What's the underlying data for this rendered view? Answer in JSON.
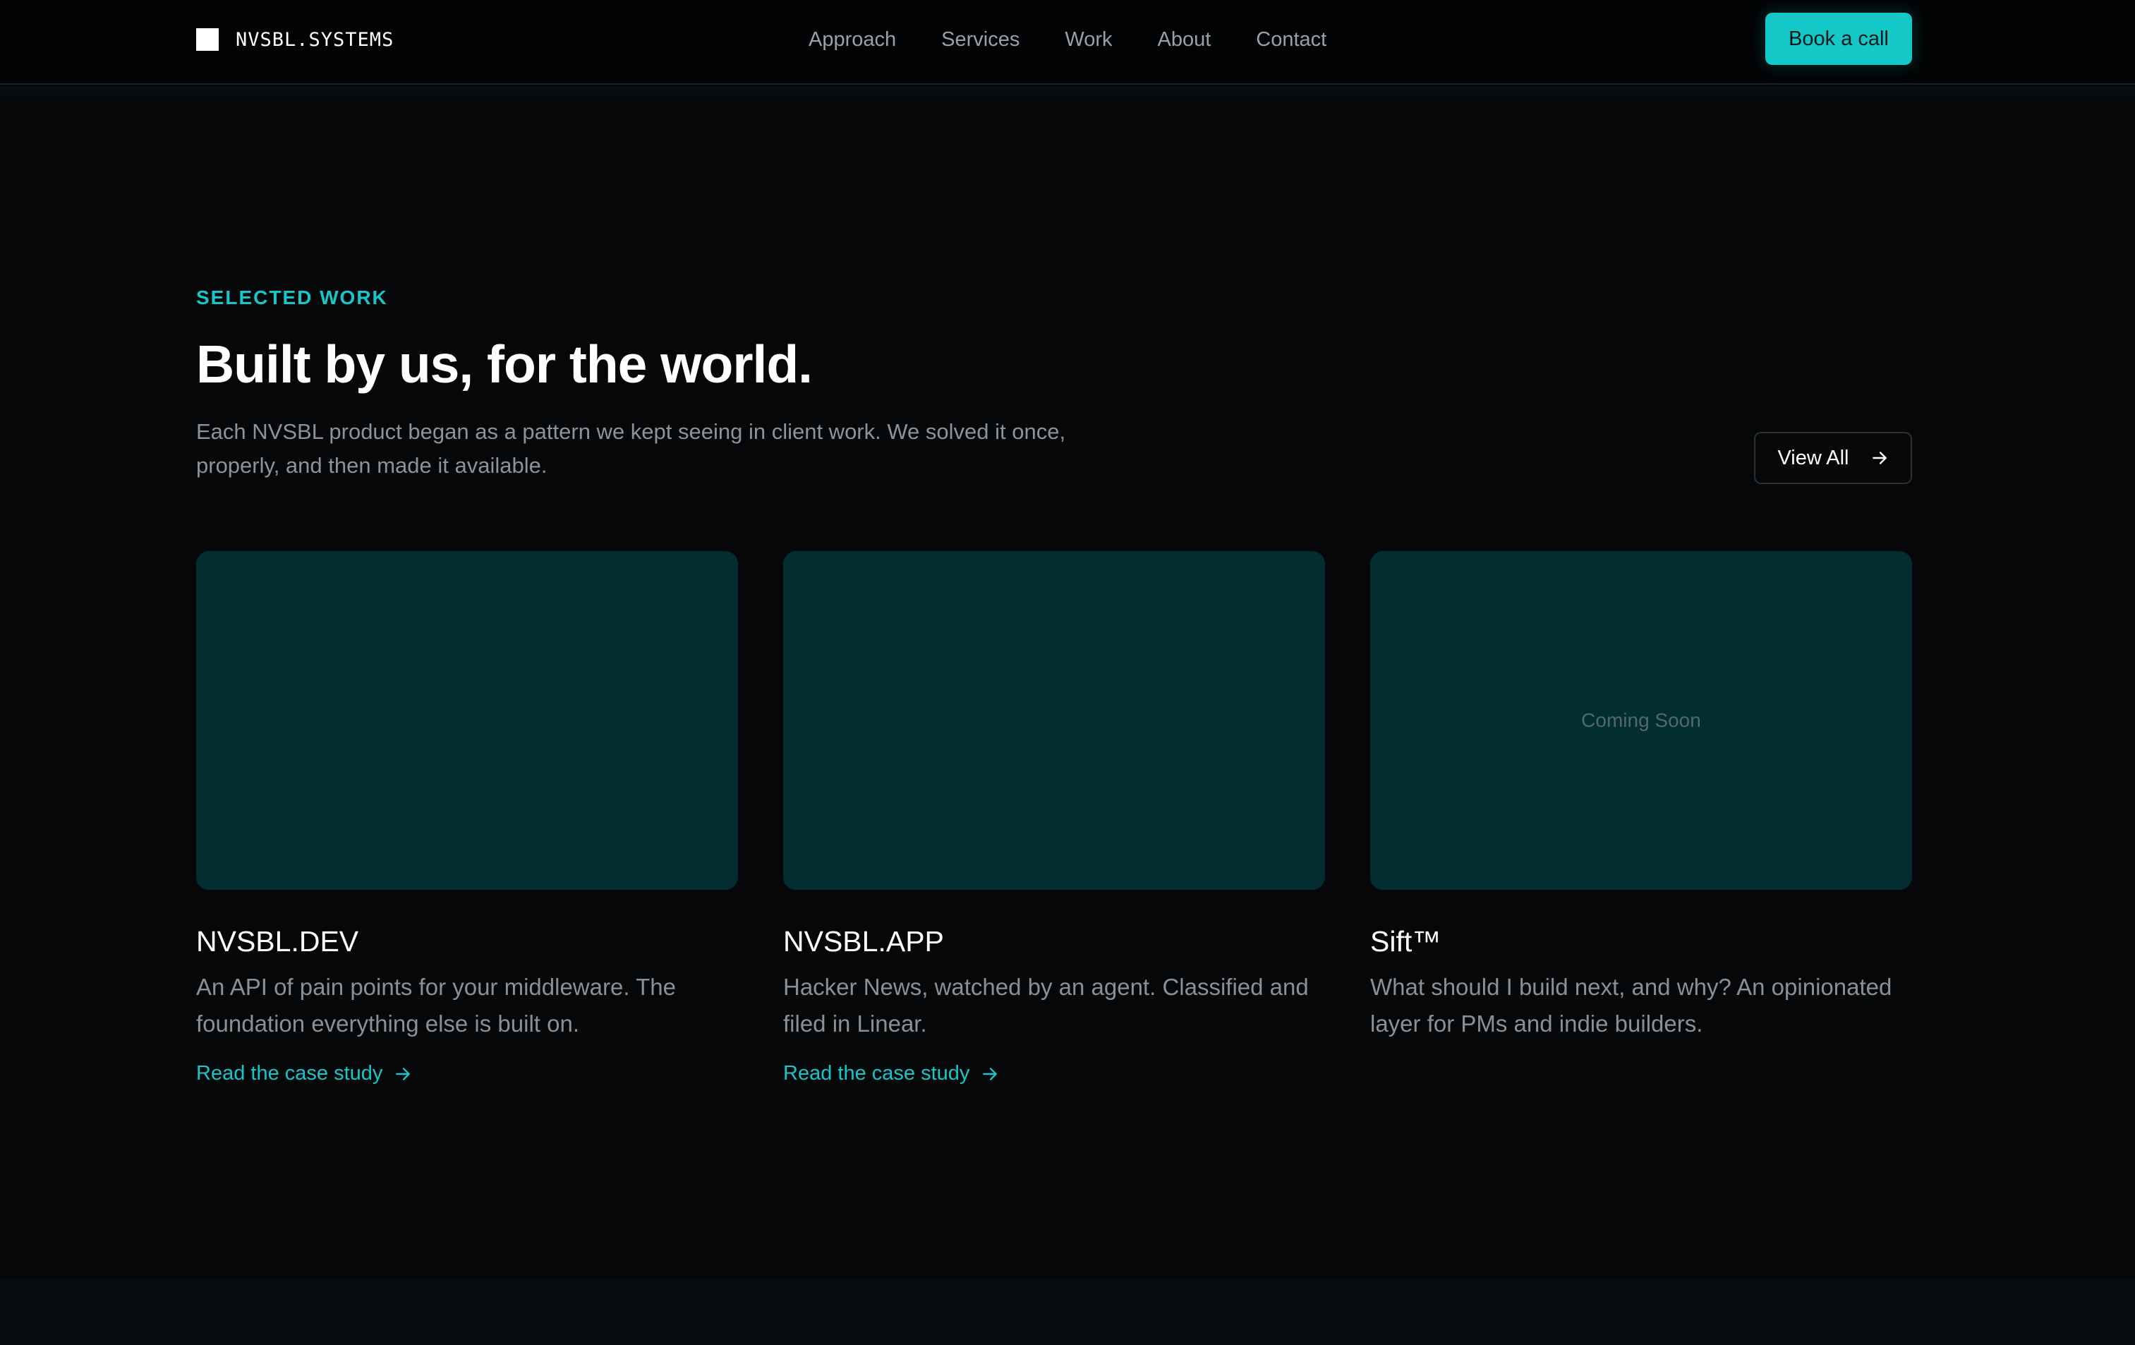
{
  "colors": {
    "accent": "#14c8c8",
    "background": "#050709",
    "card_bg": "#022e31"
  },
  "header": {
    "brand_icon": "white-square-logo",
    "brand_name": "NVSBL.SYSTEMS",
    "nav": [
      "Approach",
      "Services",
      "Work",
      "About",
      "Contact"
    ],
    "cta_label": "Book a call"
  },
  "section": {
    "eyebrow": "SELECTED WORK",
    "title": "Built by us, for the world.",
    "intro": "Each NVSBL product began as a pattern we kept seeing in client work. We solved it once, properly, and then made it available.",
    "view_all_label": "View All",
    "view_all_icon": "arrow-right-icon"
  },
  "cards": [
    {
      "title": "NVSBL.DEV",
      "description": "An API of pain points for your middleware. The foundation everything else is built on.",
      "link_label": "Read the case study",
      "link_icon": "arrow-right-icon"
    },
    {
      "title": "NVSBL.APP",
      "description": "Hacker News, watched by an agent. Classified and filed in Linear.",
      "link_label": "Read the case study",
      "link_icon": "arrow-right-icon"
    },
    {
      "title": "Sift™",
      "description": "What should I build next, and why? An opinionated layer for PMs and indie builders.",
      "thumb_label": "Coming Soon"
    }
  ]
}
